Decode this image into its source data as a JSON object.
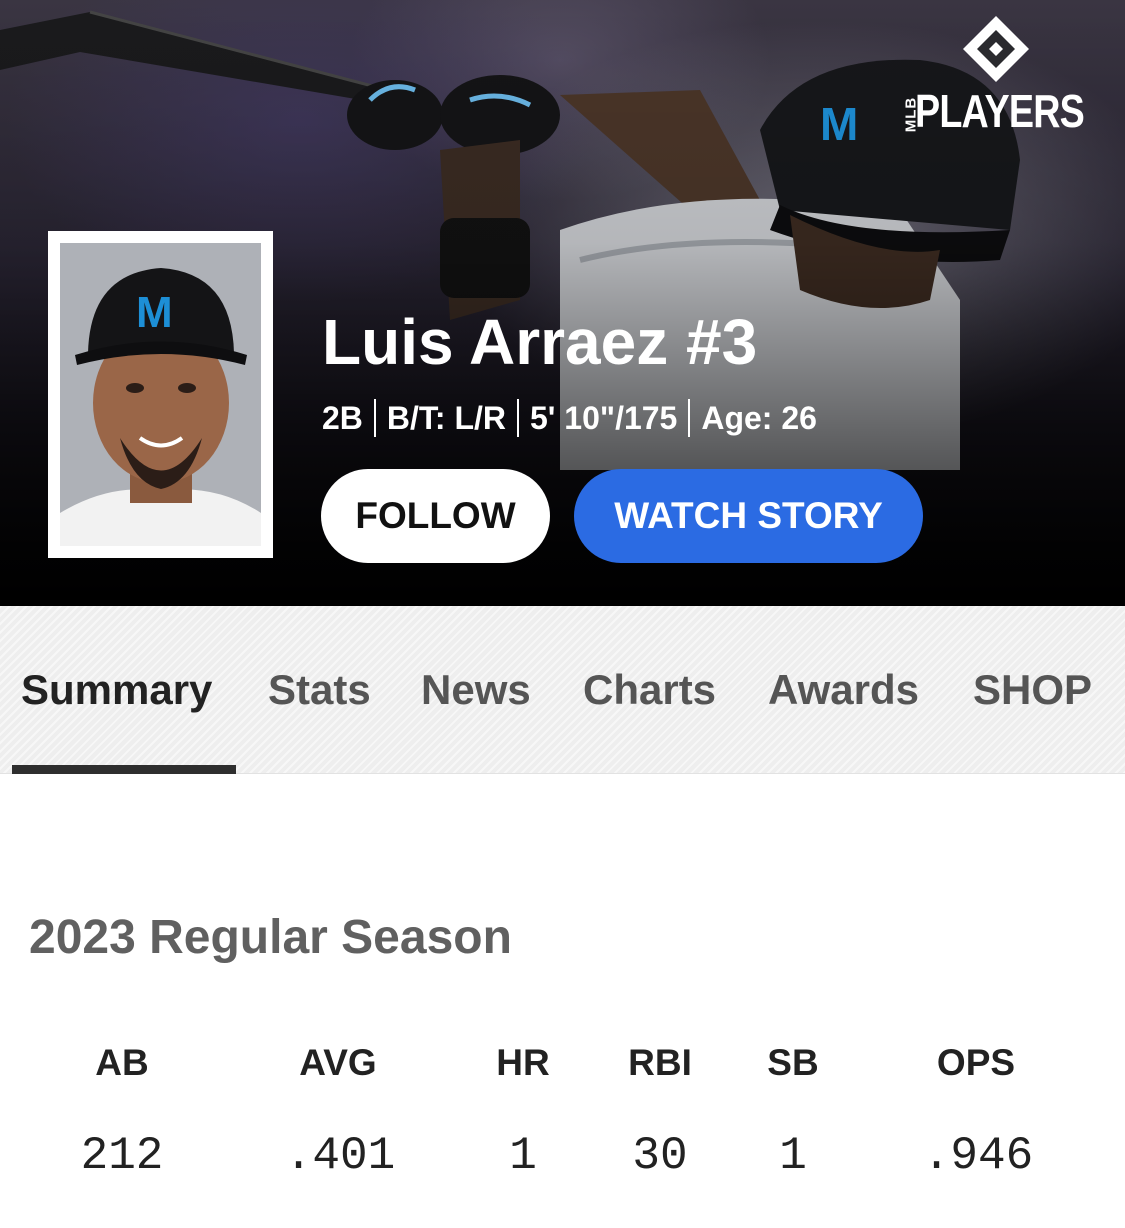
{
  "brand": {
    "top": "MLB",
    "name": "PLAYERS"
  },
  "player": {
    "name": "Luis Arraez #3",
    "bio": [
      "2B",
      "B/T: L/R",
      "5' 10\"/175",
      "Age: 26"
    ]
  },
  "actions": {
    "follow": "FOLLOW",
    "watch": "WATCH STORY"
  },
  "tabs": [
    {
      "label": "Summary",
      "active": true
    },
    {
      "label": "Stats",
      "active": false
    },
    {
      "label": "News",
      "active": false
    },
    {
      "label": "Charts",
      "active": false
    },
    {
      "label": "Awards",
      "active": false
    },
    {
      "label": "SHOP",
      "active": false
    }
  ],
  "season": {
    "title": "2023 Regular Season",
    "stats": [
      {
        "label": "AB",
        "value": "212"
      },
      {
        "label": "AVG",
        "value": ".401"
      },
      {
        "label": "HR",
        "value": "1"
      },
      {
        "label": "RBI",
        "value": "30"
      },
      {
        "label": "SB",
        "value": "1"
      },
      {
        "label": "OPS",
        "value": ".946"
      }
    ]
  },
  "colors": {
    "accent": "#2b6be3",
    "tab_underline": "#2e2e2e",
    "hero_bg": "#000000"
  }
}
